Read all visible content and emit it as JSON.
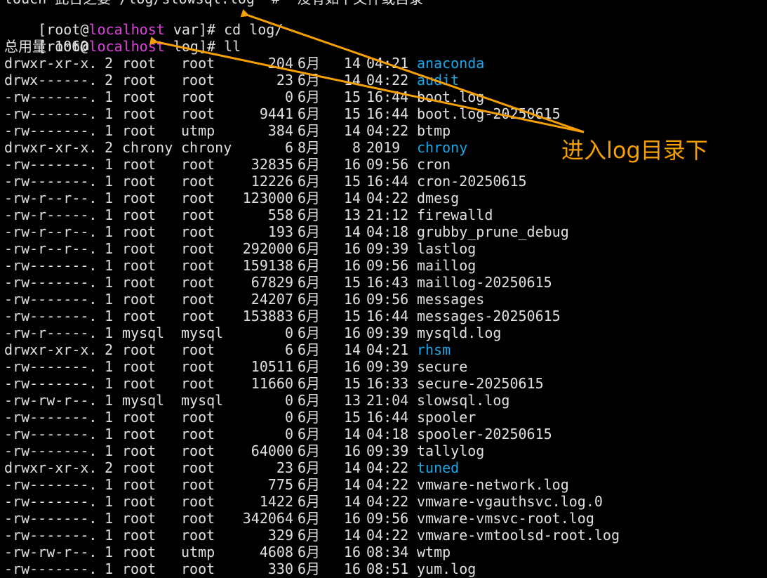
{
  "terminal": {
    "top_partial": "touch 此日之要 /log/slowsql.log  #  没有如下文件或目录",
    "prompt1": {
      "open": "[root@",
      "host": "localhost",
      "rest": " var]# cd log/"
    },
    "prompt2": {
      "open": "[root@",
      "host": "localhost",
      "rest": " log]# ll"
    },
    "total": "总用量 1060",
    "rows": [
      {
        "perm": "drwxr-xr-x.",
        "links": "2",
        "user": "root",
        "group": "root",
        "size": "204",
        "month": "6月",
        "day": "14",
        "time": "04:21",
        "name": "anaconda",
        "dir": true
      },
      {
        "perm": "drwx------.",
        "links": "2",
        "user": "root",
        "group": "root",
        "size": "23",
        "month": "6月",
        "day": "14",
        "time": "04:22",
        "name": "audit",
        "dir": true
      },
      {
        "perm": "-rw-------.",
        "links": "1",
        "user": "root",
        "group": "root",
        "size": "0",
        "month": "6月",
        "day": "15",
        "time": "16:44",
        "name": "boot.log",
        "dir": false
      },
      {
        "perm": "-rw-------.",
        "links": "1",
        "user": "root",
        "group": "root",
        "size": "9441",
        "month": "6月",
        "day": "15",
        "time": "16:44",
        "name": "boot.log-20250615",
        "dir": false
      },
      {
        "perm": "-rw-------.",
        "links": "1",
        "user": "root",
        "group": "utmp",
        "size": "384",
        "month": "6月",
        "day": "14",
        "time": "04:22",
        "name": "btmp",
        "dir": false
      },
      {
        "perm": "drwxr-xr-x.",
        "links": "2",
        "user": "chrony",
        "group": "chrony",
        "size": "6",
        "month": "8月",
        "day": "8",
        "time": "2019",
        "name": "chrony",
        "dir": true
      },
      {
        "perm": "-rw-------.",
        "links": "1",
        "user": "root",
        "group": "root",
        "size": "32835",
        "month": "6月",
        "day": "16",
        "time": "09:56",
        "name": "cron",
        "dir": false
      },
      {
        "perm": "-rw-------.",
        "links": "1",
        "user": "root",
        "group": "root",
        "size": "12226",
        "month": "6月",
        "day": "15",
        "time": "16:44",
        "name": "cron-20250615",
        "dir": false
      },
      {
        "perm": "-rw-r--r--.",
        "links": "1",
        "user": "root",
        "group": "root",
        "size": "123000",
        "month": "6月",
        "day": "14",
        "time": "04:22",
        "name": "dmesg",
        "dir": false
      },
      {
        "perm": "-rw-r-----.",
        "links": "1",
        "user": "root",
        "group": "root",
        "size": "558",
        "month": "6月",
        "day": "13",
        "time": "21:12",
        "name": "firewalld",
        "dir": false
      },
      {
        "perm": "-rw-r--r--.",
        "links": "1",
        "user": "root",
        "group": "root",
        "size": "193",
        "month": "6月",
        "day": "14",
        "time": "04:18",
        "name": "grubby_prune_debug",
        "dir": false
      },
      {
        "perm": "-rw-r--r--.",
        "links": "1",
        "user": "root",
        "group": "root",
        "size": "292000",
        "month": "6月",
        "day": "16",
        "time": "09:39",
        "name": "lastlog",
        "dir": false
      },
      {
        "perm": "-rw-------.",
        "links": "1",
        "user": "root",
        "group": "root",
        "size": "159138",
        "month": "6月",
        "day": "16",
        "time": "09:56",
        "name": "maillog",
        "dir": false
      },
      {
        "perm": "-rw-------.",
        "links": "1",
        "user": "root",
        "group": "root",
        "size": "67829",
        "month": "6月",
        "day": "15",
        "time": "16:43",
        "name": "maillog-20250615",
        "dir": false
      },
      {
        "perm": "-rw-------.",
        "links": "1",
        "user": "root",
        "group": "root",
        "size": "24207",
        "month": "6月",
        "day": "16",
        "time": "09:56",
        "name": "messages",
        "dir": false
      },
      {
        "perm": "-rw-------.",
        "links": "1",
        "user": "root",
        "group": "root",
        "size": "153883",
        "month": "6月",
        "day": "15",
        "time": "16:44",
        "name": "messages-20250615",
        "dir": false
      },
      {
        "perm": "-rw-r-----.",
        "links": "1",
        "user": "mysql",
        "group": "mysql",
        "size": "0",
        "month": "6月",
        "day": "16",
        "time": "09:39",
        "name": "mysqld.log",
        "dir": false
      },
      {
        "perm": "drwxr-xr-x.",
        "links": "2",
        "user": "root",
        "group": "root",
        "size": "6",
        "month": "6月",
        "day": "14",
        "time": "04:21",
        "name": "rhsm",
        "dir": true
      },
      {
        "perm": "-rw-------.",
        "links": "1",
        "user": "root",
        "group": "root",
        "size": "10511",
        "month": "6月",
        "day": "16",
        "time": "09:39",
        "name": "secure",
        "dir": false
      },
      {
        "perm": "-rw-------.",
        "links": "1",
        "user": "root",
        "group": "root",
        "size": "11660",
        "month": "6月",
        "day": "15",
        "time": "16:33",
        "name": "secure-20250615",
        "dir": false
      },
      {
        "perm": "-rw-rw-r--.",
        "links": "1",
        "user": "mysql",
        "group": "mysql",
        "size": "0",
        "month": "6月",
        "day": "13",
        "time": "21:04",
        "name": "slowsql.log",
        "dir": false
      },
      {
        "perm": "-rw-------.",
        "links": "1",
        "user": "root",
        "group": "root",
        "size": "0",
        "month": "6月",
        "day": "15",
        "time": "16:44",
        "name": "spooler",
        "dir": false
      },
      {
        "perm": "-rw-------.",
        "links": "1",
        "user": "root",
        "group": "root",
        "size": "0",
        "month": "6月",
        "day": "14",
        "time": "04:18",
        "name": "spooler-20250615",
        "dir": false
      },
      {
        "perm": "-rw-------.",
        "links": "1",
        "user": "root",
        "group": "root",
        "size": "64000",
        "month": "6月",
        "day": "16",
        "time": "09:39",
        "name": "tallylog",
        "dir": false
      },
      {
        "perm": "drwxr-xr-x.",
        "links": "2",
        "user": "root",
        "group": "root",
        "size": "23",
        "month": "6月",
        "day": "14",
        "time": "04:22",
        "name": "tuned",
        "dir": true
      },
      {
        "perm": "-rw-------.",
        "links": "1",
        "user": "root",
        "group": "root",
        "size": "775",
        "month": "6月",
        "day": "14",
        "time": "04:22",
        "name": "vmware-network.log",
        "dir": false
      },
      {
        "perm": "-rw-------.",
        "links": "1",
        "user": "root",
        "group": "root",
        "size": "1422",
        "month": "6月",
        "day": "14",
        "time": "04:22",
        "name": "vmware-vgauthsvc.log.0",
        "dir": false
      },
      {
        "perm": "-rw-------.",
        "links": "1",
        "user": "root",
        "group": "root",
        "size": "342064",
        "month": "6月",
        "day": "16",
        "time": "09:56",
        "name": "vmware-vmsvc-root.log",
        "dir": false
      },
      {
        "perm": "-rw-------.",
        "links": "1",
        "user": "root",
        "group": "root",
        "size": "329",
        "month": "6月",
        "day": "14",
        "time": "04:22",
        "name": "vmware-vmtoolsd-root.log",
        "dir": false
      },
      {
        "perm": "-rw-rw-r--.",
        "links": "1",
        "user": "root",
        "group": "utmp",
        "size": "4608",
        "month": "6月",
        "day": "16",
        "time": "08:34",
        "name": "wtmp",
        "dir": false
      },
      {
        "perm": "-rw-------.",
        "links": "1",
        "user": "root",
        "group": "root",
        "size": "330",
        "month": "6月",
        "day": "16",
        "time": "08:51",
        "name": "yum.log",
        "dir": false
      }
    ]
  },
  "annotation": {
    "label": "进入log目录下",
    "color": "#f5a000"
  },
  "colors": {
    "background": "#000000",
    "text": "#e0e0e0",
    "hostname": "#e040e0",
    "directory": "#1aa8e8"
  }
}
